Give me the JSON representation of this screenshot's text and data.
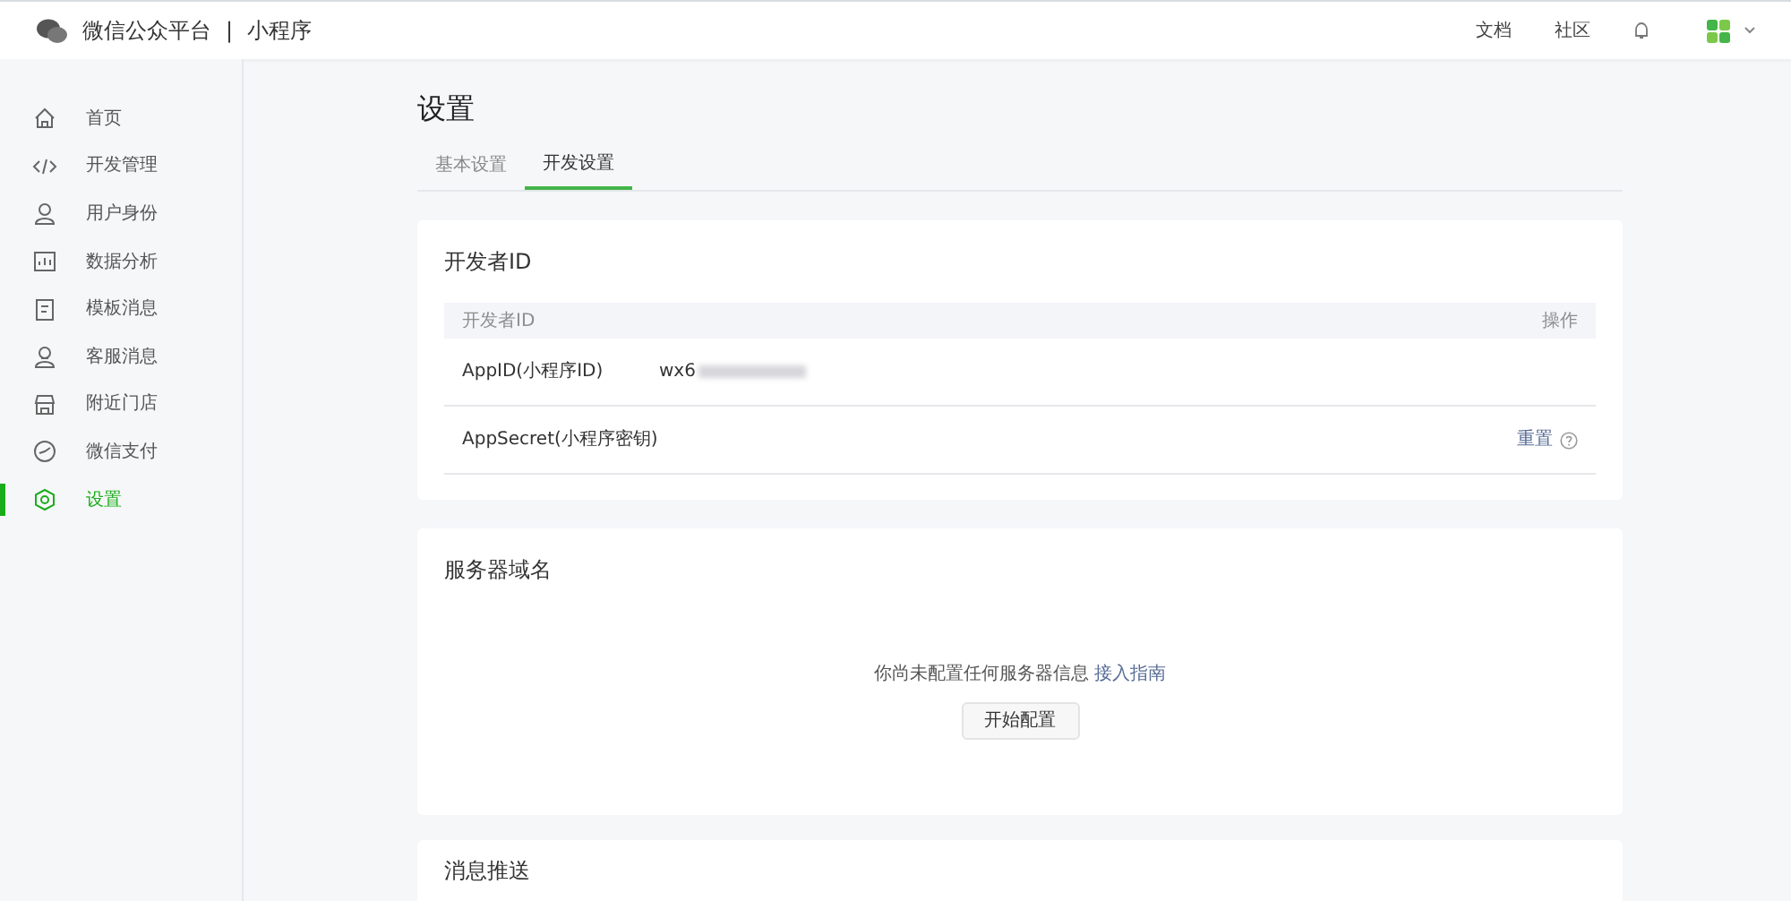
{
  "header": {
    "brand": "微信公众平台",
    "divider": "|",
    "product": "小程序",
    "links": [
      "文档",
      "社区"
    ]
  },
  "sidebar": {
    "items": [
      {
        "label": "首页",
        "selected": false
      },
      {
        "label": "开发管理",
        "selected": false
      },
      {
        "label": "用户身份",
        "selected": false
      },
      {
        "label": "数据分析",
        "selected": false
      },
      {
        "label": "模板消息",
        "selected": false
      },
      {
        "label": "客服消息",
        "selected": false
      },
      {
        "label": "附近门店",
        "selected": false
      },
      {
        "label": "微信支付",
        "selected": false
      },
      {
        "label": "设置",
        "selected": true
      }
    ]
  },
  "page_title": "设置",
  "tabs": [
    {
      "label": "基本设置",
      "selected": false
    },
    {
      "label": "开发设置",
      "selected": true
    }
  ],
  "developer_id": {
    "title": "开发者ID",
    "columns": [
      "开发者ID",
      "操作"
    ],
    "rows": [
      {
        "label": "AppID(小程序ID)",
        "value": "wx6",
        "redacted": true
      },
      {
        "label": "AppSecret(小程序密钥)",
        "action": "重置",
        "help": true
      }
    ]
  },
  "server_domain": {
    "title": "服务器域名",
    "message": "你尚未配置任何服务器信息",
    "link": "接入指南",
    "button": "开始配置"
  },
  "message_push": {
    "title": "消息推送"
  }
}
